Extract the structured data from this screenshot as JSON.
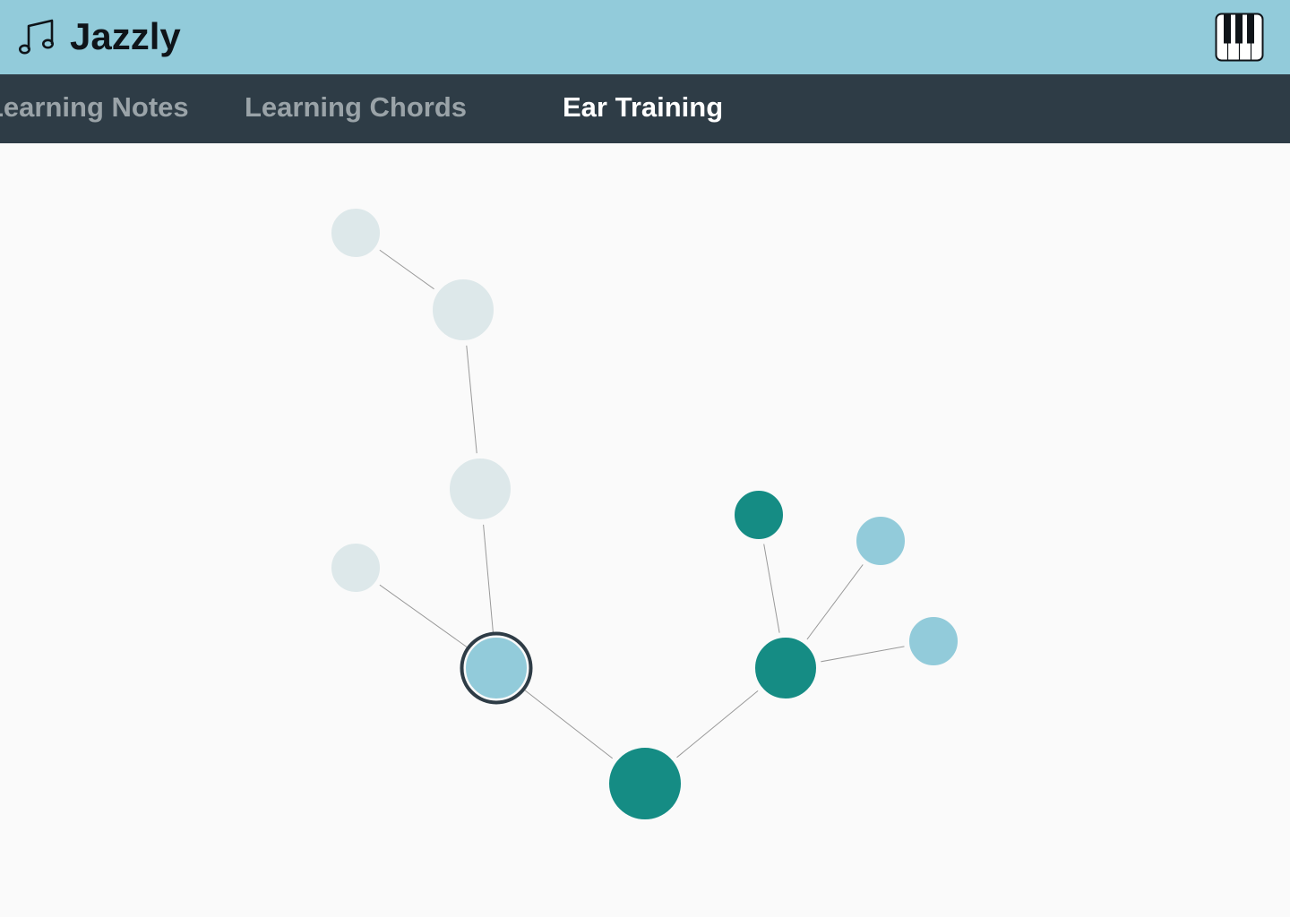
{
  "app": {
    "title": "Jazzly",
    "brand_icon": "music-notes-icon",
    "piano_icon": "piano-keys-icon"
  },
  "nav": {
    "tabs": [
      {
        "label": "Learning Notes",
        "active": false
      },
      {
        "label": "Learning Chords",
        "active": false
      },
      {
        "label": "Ear Training",
        "active": true
      }
    ]
  },
  "colors": {
    "header_bg": "#92cbda",
    "nav_bg": "#2e3c46",
    "nav_inactive": "#9aa3a8",
    "nav_active": "#ffffff",
    "node_locked": "#dde8ea",
    "node_available": "#92cbda",
    "node_completed": "#158c84",
    "node_selected_ring": "#2e3c46",
    "edge": "#999999",
    "canvas_bg": "#fafafa"
  },
  "skill_tree": {
    "nodes": [
      {
        "id": "root",
        "state": "completed",
        "selected": false
      },
      {
        "id": "left-branch",
        "state": "available",
        "selected": true
      },
      {
        "id": "left-side",
        "state": "locked",
        "selected": false
      },
      {
        "id": "left-upper",
        "state": "locked",
        "selected": false
      },
      {
        "id": "left-top",
        "state": "locked",
        "selected": false
      },
      {
        "id": "left-top-leaf",
        "state": "locked",
        "selected": false
      },
      {
        "id": "right-branch",
        "state": "completed",
        "selected": false
      },
      {
        "id": "right-top",
        "state": "completed",
        "selected": false
      },
      {
        "id": "right-upper",
        "state": "available",
        "selected": false
      },
      {
        "id": "right-side",
        "state": "available",
        "selected": false
      }
    ],
    "edges": [
      [
        "root",
        "left-branch"
      ],
      [
        "root",
        "right-branch"
      ],
      [
        "left-branch",
        "left-side"
      ],
      [
        "left-branch",
        "left-upper"
      ],
      [
        "left-upper",
        "left-top"
      ],
      [
        "left-top",
        "left-top-leaf"
      ],
      [
        "right-branch",
        "right-top"
      ],
      [
        "right-branch",
        "right-upper"
      ],
      [
        "right-branch",
        "right-side"
      ]
    ]
  }
}
